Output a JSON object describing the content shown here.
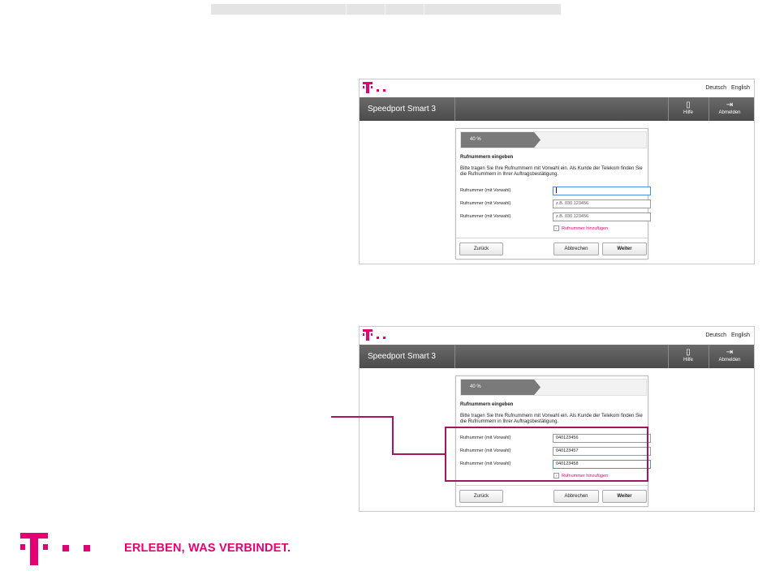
{
  "brand_color": "#e20074",
  "header": {
    "lang_de": "Deutsch",
    "lang_en": "English",
    "app_title": "Speedport Smart 3",
    "help_label": "Hilfe",
    "logout_label": "Abmelden"
  },
  "dialog": {
    "progress_label": "40 %",
    "progress_value": 0.43,
    "title": "Rufnummern eingeben",
    "description": "Bitte tragen Sie Ihre Rufnummern mit Vorwahl ein. Als Kunde der Telekom finden Sie die Rufnummern in Ihrer Auftragsbestätigung.",
    "field_label": "Rufnummer (mit Vorwahl)",
    "placeholder": "z.B. 030 123456",
    "add_link": "Rufnummer hinzufügen",
    "back_button": "Zurück",
    "cancel_button": "Abbrechen",
    "next_button": "Weiter"
  },
  "screen2_values": [
    "040123456",
    "040123457",
    "040123458"
  ],
  "footer": {
    "slogan": "ERLEBEN, WAS VERBINDET."
  }
}
